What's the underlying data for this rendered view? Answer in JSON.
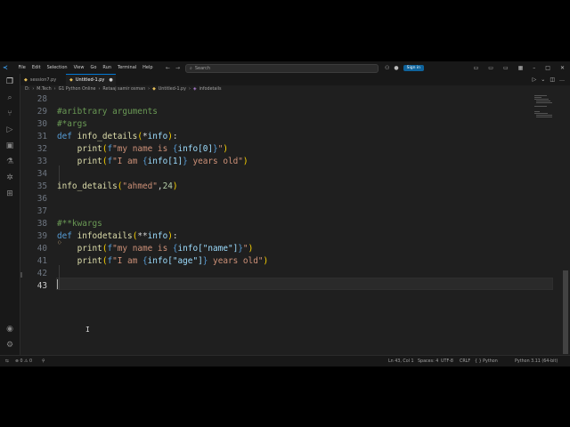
{
  "title_bar": {
    "menus": [
      "File",
      "Edit",
      "Selection",
      "View",
      "Go",
      "Run",
      "Terminal",
      "Help"
    ],
    "search_placeholder": "Search",
    "sign_in": "Sign in"
  },
  "tabs": [
    {
      "label": "session7.py",
      "active": false
    },
    {
      "label": "Untitled-1.py",
      "active": true
    }
  ],
  "breadcrumbs": [
    "D:",
    "M.Tech",
    "G1 Python Online",
    "Retaaj samir osman",
    "Untitled-1.py",
    "infodetails"
  ],
  "editor": {
    "current_line": 43,
    "lines": [
      {
        "n": "28",
        "t": ""
      },
      {
        "n": "29",
        "t": "#aribtrary arguments"
      },
      {
        "n": "30",
        "t": "#*args"
      },
      {
        "n": "31",
        "t": "def info_details(*info):"
      },
      {
        "n": "32",
        "t": "    print(f\"my name is {info[0]}\")"
      },
      {
        "n": "33",
        "t": "    print(f\"I am {info[1]} years old\")"
      },
      {
        "n": "34",
        "t": ""
      },
      {
        "n": "35",
        "t": "info_details(\"ahmed\",24)"
      },
      {
        "n": "36",
        "t": ""
      },
      {
        "n": "37",
        "t": ""
      },
      {
        "n": "38",
        "t": "#**kwargs"
      },
      {
        "n": "39",
        "t": "def infodetails(**info):"
      },
      {
        "n": "40",
        "t": "    print(f\"my name is {info[\"name\"]}\")"
      },
      {
        "n": "41",
        "t": "    print(f\"I am {info[\"age\"]} years old\")"
      },
      {
        "n": "42",
        "t": ""
      },
      {
        "n": "43",
        "t": ""
      }
    ]
  },
  "status_bar": {
    "problems": "⊗ 0 ⚠ 0",
    "position": "Ln 43, Col 1",
    "spaces": "Spaces: 4",
    "encoding": "UTF-8",
    "eol": "CRLF",
    "language": "{ } Python",
    "interpreter": "Python 3.11 (64-bit)"
  },
  "colors": {
    "accent": "#0078d4",
    "keyword": "#569cd6",
    "function": "#dcdcaa",
    "string": "#ce9178",
    "comment": "#6a9955"
  }
}
